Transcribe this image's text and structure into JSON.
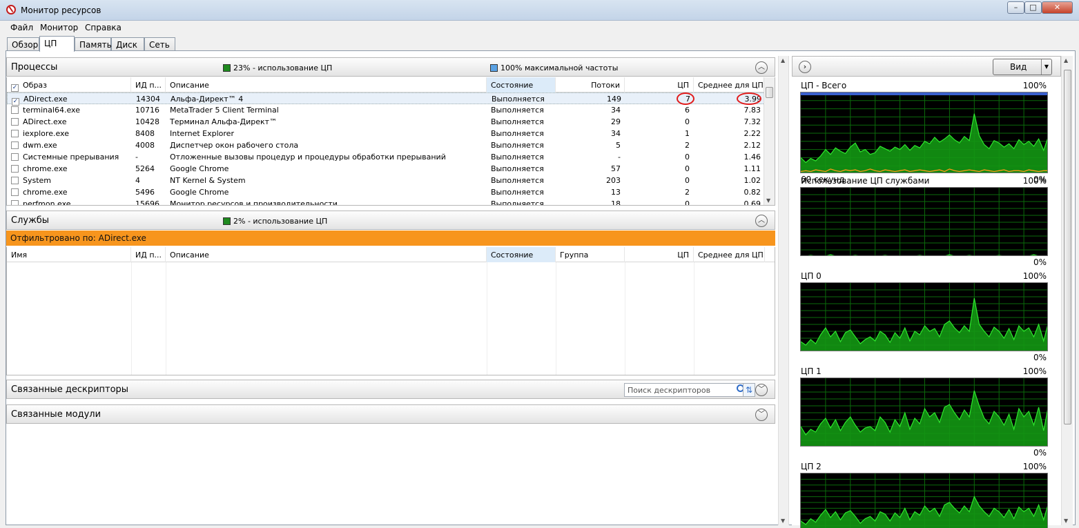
{
  "window": {
    "title": "Монитор ресурсов",
    "min": "–",
    "max": "□",
    "close": "✕"
  },
  "menu": [
    "Файл",
    "Монитор",
    "Справка"
  ],
  "tabs": [
    "Обзор",
    "ЦП",
    "Память",
    "Диск",
    "Сеть"
  ],
  "active_tab": 1,
  "processes": {
    "title": "Процессы",
    "legend_cpu": "23% - использование ЦП",
    "legend_freq": "100% максимальной частоты",
    "legend_cpu_color": "#1f8a1f",
    "legend_freq_color": "#5aa2e4",
    "columns": [
      "Образ",
      "ИД п...",
      "Описание",
      "Состояние",
      "Потоки",
      "ЦП",
      "Среднее для ЦП"
    ],
    "rows": [
      {
        "checked": true,
        "image": "ADirect.exe",
        "pid": "14304",
        "desc": "Альфа-Директ™ 4",
        "state": "Выполняется",
        "threads": "149",
        "cpu": "7",
        "avg": "3.99"
      },
      {
        "checked": false,
        "image": "terminal64.exe",
        "pid": "10716",
        "desc": "MetaTrader 5 Client Terminal",
        "state": "Выполняется",
        "threads": "34",
        "cpu": "6",
        "avg": "7.83"
      },
      {
        "checked": false,
        "image": "ADirect.exe",
        "pid": "10428",
        "desc": "Терминал Альфа-Директ™",
        "state": "Выполняется",
        "threads": "29",
        "cpu": "0",
        "avg": "7.32"
      },
      {
        "checked": false,
        "image": "iexplore.exe",
        "pid": "8408",
        "desc": "Internet Explorer",
        "state": "Выполняется",
        "threads": "34",
        "cpu": "1",
        "avg": "2.22"
      },
      {
        "checked": false,
        "image": "dwm.exe",
        "pid": "4008",
        "desc": "Диспетчер окон рабочего стола",
        "state": "Выполняется",
        "threads": "5",
        "cpu": "2",
        "avg": "2.12"
      },
      {
        "checked": false,
        "image": "Системные прерывания",
        "pid": "-",
        "desc": "Отложенные вызовы процедур и процедуры обработки прерываний",
        "state": "Выполняется",
        "threads": "-",
        "cpu": "0",
        "avg": "1.46"
      },
      {
        "checked": false,
        "image": "chrome.exe",
        "pid": "5264",
        "desc": "Google Chrome",
        "state": "Выполняется",
        "threads": "57",
        "cpu": "0",
        "avg": "1.11"
      },
      {
        "checked": false,
        "image": "System",
        "pid": "4",
        "desc": "NT Kernel & System",
        "state": "Выполняется",
        "threads": "203",
        "cpu": "0",
        "avg": "1.02"
      },
      {
        "checked": false,
        "image": "chrome.exe",
        "pid": "5496",
        "desc": "Google Chrome",
        "state": "Выполняется",
        "threads": "13",
        "cpu": "2",
        "avg": "0.82"
      },
      {
        "checked": false,
        "image": "perfmon.exe",
        "pid": "15696",
        "desc": "Монитор ресурсов и производительности",
        "state": "Выполняется",
        "threads": "18",
        "cpu": "0",
        "avg": "0.69"
      }
    ]
  },
  "services": {
    "title": "Службы",
    "legend_cpu": "2% - использование ЦП",
    "filter": "Отфильтровано по: ADirect.exe",
    "filter_color": "#f7951d",
    "columns": [
      "Имя",
      "ИД п...",
      "Описание",
      "Состояние",
      "Группа",
      "ЦП",
      "Среднее для ЦП"
    ]
  },
  "handles": {
    "title": "Связанные дескрипторы",
    "search_placeholder": "Поиск дескрипторов"
  },
  "modules": {
    "title": "Связанные модули"
  },
  "right_panel": {
    "view_label": "Вид",
    "graphs": [
      {
        "title": "ЦП - Всего",
        "max": "100%",
        "foot_left": "60 секунд",
        "foot_right": "0%",
        "values": [
          20,
          14,
          19,
          16,
          22,
          30,
          24,
          32,
          28,
          25,
          33,
          38,
          27,
          30,
          24,
          26,
          34,
          31,
          28,
          33,
          30,
          36,
          29,
          35,
          32,
          40,
          37,
          45,
          39,
          43,
          48,
          42,
          38,
          46,
          41,
          74,
          47,
          36,
          31,
          41,
          38,
          33,
          37,
          31,
          42,
          36,
          40,
          34,
          43,
          29,
          47
        ],
        "orange": [
          3,
          4,
          3,
          5,
          4,
          3,
          6,
          4,
          3,
          5,
          4,
          5,
          3,
          4,
          6,
          4,
          3,
          5,
          4,
          3,
          4,
          5,
          3,
          4,
          5,
          4,
          3,
          4,
          5,
          3,
          6,
          4,
          3,
          4,
          5,
          4,
          3,
          5,
          4,
          3,
          4,
          5,
          3,
          4,
          4,
          3,
          5,
          4,
          3,
          4,
          4
        ]
      },
      {
        "title": "Использование ЦП службами",
        "max": "100%",
        "foot_left": "",
        "foot_right": "0%",
        "values": [
          1,
          1,
          2,
          1,
          1,
          1,
          3,
          1,
          1,
          1,
          1,
          2,
          1,
          1,
          1,
          1,
          1,
          2,
          1,
          1,
          1,
          1,
          1,
          1,
          2,
          1,
          1,
          1,
          1,
          1,
          3,
          1,
          1,
          1,
          2,
          1,
          1,
          1,
          1,
          1,
          2,
          1,
          1,
          1,
          1,
          1,
          1,
          3,
          1,
          1,
          1
        ]
      },
      {
        "title": "ЦП 0",
        "max": "100%",
        "foot_left": "",
        "foot_right": "0%",
        "values": [
          15,
          10,
          18,
          12,
          25,
          35,
          22,
          30,
          15,
          28,
          32,
          22,
          12,
          18,
          22,
          16,
          30,
          25,
          14,
          28,
          20,
          35,
          16,
          30,
          25,
          38,
          30,
          34,
          22,
          40,
          45,
          35,
          28,
          38,
          30,
          78,
          40,
          30,
          22,
          36,
          30,
          20,
          34,
          18,
          38,
          30,
          35,
          22,
          40,
          16,
          44
        ]
      },
      {
        "title": "ЦП 1",
        "max": "100%",
        "foot_left": "",
        "foot_right": "0%",
        "values": [
          30,
          18,
          26,
          22,
          34,
          42,
          28,
          40,
          24,
          36,
          44,
          32,
          22,
          28,
          30,
          24,
          44,
          36,
          22,
          40,
          30,
          50,
          26,
          42,
          34,
          56,
          44,
          50,
          36,
          58,
          62,
          50,
          40,
          54,
          44,
          82,
          60,
          42,
          34,
          52,
          44,
          32,
          48,
          26,
          56,
          44,
          52,
          32,
          58,
          24,
          62
        ]
      },
      {
        "title": "ЦП 2",
        "max": "100%",
        "foot_left": "",
        "foot_right": "",
        "values": [
          18,
          12,
          22,
          16,
          28,
          38,
          24,
          34,
          20,
          32,
          36,
          26,
          14,
          22,
          26,
          18,
          34,
          30,
          18,
          32,
          24,
          40,
          20,
          34,
          28,
          44,
          34,
          40,
          26,
          46,
          50,
          40,
          32,
          44,
          34,
          60,
          44,
          34,
          26,
          40,
          34,
          24,
          38,
          22,
          42,
          34,
          40,
          26,
          46,
          20,
          50
        ]
      }
    ]
  }
}
